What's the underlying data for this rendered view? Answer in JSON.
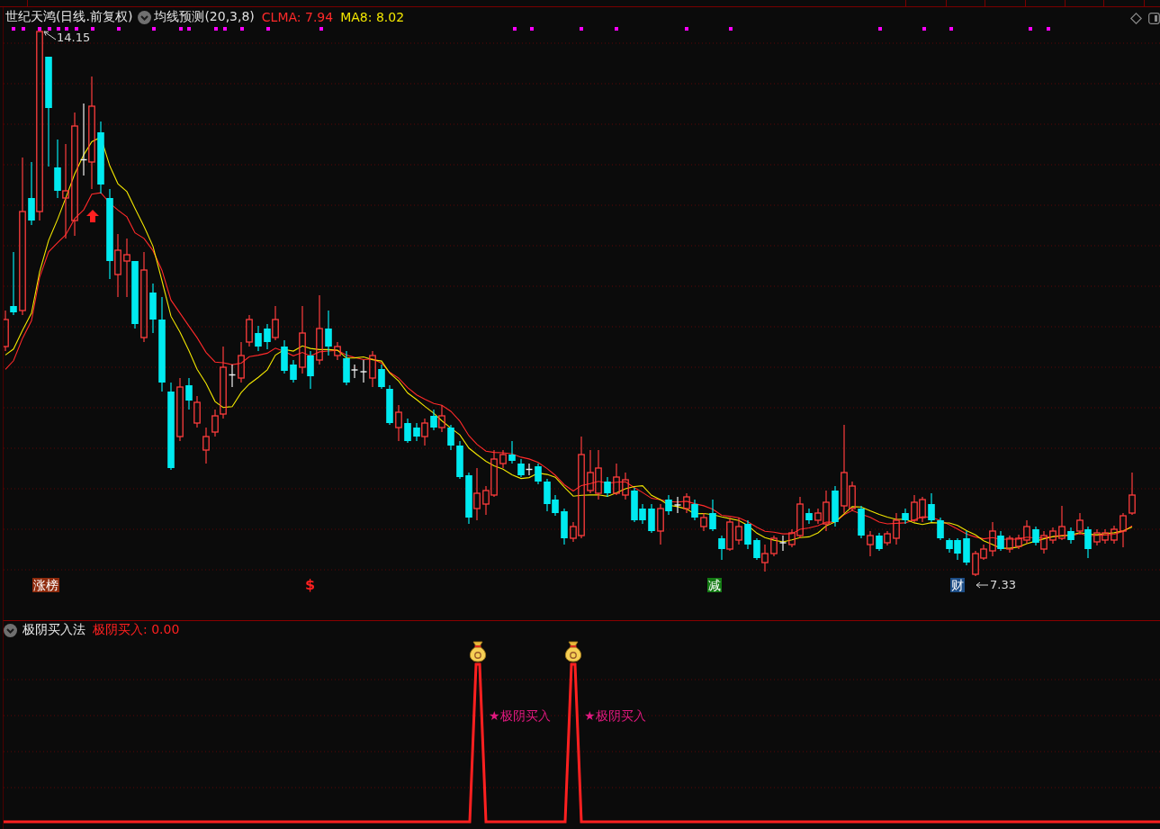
{
  "main_chart": {
    "header": {
      "title": "世纪天鸿(日线.前复权)",
      "indicator": "均线预测(20,3,8)",
      "legend": [
        {
          "label": "CLMA: 7.94",
          "color": "#ff2a2a"
        },
        {
          "label": "MA8: 8.02",
          "color": "#f2e600"
        }
      ]
    },
    "high_label": "14.15",
    "low_label": "7.33",
    "markers": [
      {
        "kind": "tag",
        "text": "涨榜",
        "color": "#8e2a0c"
      },
      {
        "kind": "symbol",
        "text": "$",
        "color": "#ff2020"
      },
      {
        "kind": "tag",
        "text": "减",
        "color": "#137a13"
      },
      {
        "kind": "tag",
        "text": "财",
        "color": "#1c4d86"
      }
    ]
  },
  "indicator_panel": {
    "header": {
      "title": "极阴买入法",
      "legend": [
        {
          "label": "极阴买入: 0.00",
          "color": "#ff2020"
        }
      ]
    },
    "signals": [
      {
        "label": "★极阴买入"
      },
      {
        "label": "★极阴买入"
      }
    ]
  }
}
